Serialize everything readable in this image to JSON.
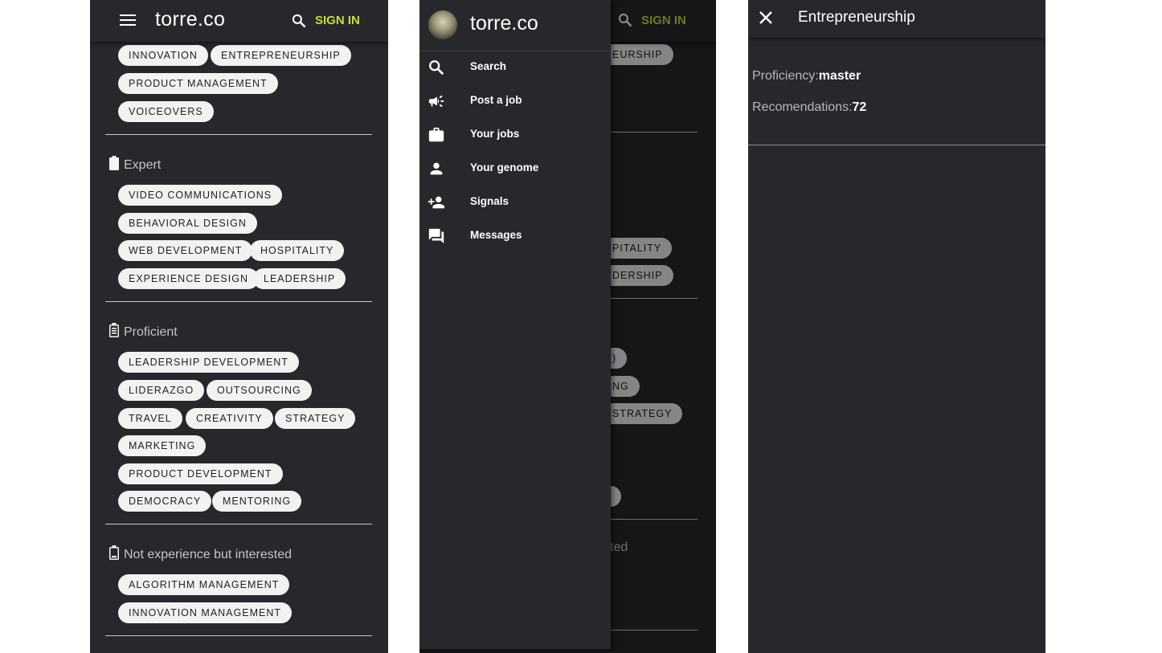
{
  "brand": "torre.co",
  "signin_label": "SIGN IN",
  "panel1": {
    "top_chips": [
      "INNOVATION",
      "ENTREPRENEURSHIP",
      "PRODUCT MANAGEMENT",
      "VOICEOVERS"
    ],
    "sections": [
      {
        "title": "Expert",
        "chips": [
          "VIDEO COMMUNICATIONS",
          "BEHAVIORAL DESIGN",
          "WEB DEVELOPMENT",
          "HOSPITALITY",
          "EXPERIENCE DESIGN",
          "LEADERSHIP"
        ]
      },
      {
        "title": "Proficient",
        "chips": [
          "LEADERSHIP DEVELOPMENT",
          "LIDERAZGO",
          "OUTSOURCING",
          "TRAVEL",
          "CREATIVITY",
          "STRATEGY",
          "MARKETING",
          "PRODUCT DEVELOPMENT",
          "DEMOCRACY",
          "MENTORING"
        ]
      },
      {
        "title": "Not experience but interested",
        "chips": [
          "ALGORITHM MANAGEMENT",
          "INNOVATION MANAGEMENT"
        ]
      }
    ]
  },
  "drawer": {
    "items": [
      {
        "label": "Search",
        "icon": "search-icon"
      },
      {
        "label": "Post a job",
        "icon": "megaphone-icon"
      },
      {
        "label": "Your jobs",
        "icon": "briefcase-icon"
      },
      {
        "label": "Your genome",
        "icon": "person-icon"
      },
      {
        "label": "Signals",
        "icon": "person-add-icon"
      },
      {
        "label": "Messages",
        "icon": "forum-icon"
      }
    ]
  },
  "panel2_bg": {
    "chips": [
      "EURSHIP",
      "PITALITY",
      "DERSHIP",
      ")",
      "NG",
      "STRATEGY",
      ""
    ],
    "text": "ted"
  },
  "detail": {
    "title": "Entrepreneurship",
    "proficiency_label": "Proficiency:",
    "proficiency_value": "master",
    "recommendations_label": "Recomendations:",
    "recommendations_value": "72"
  },
  "colors": {
    "background": "#27282c",
    "accent": "#cddc39",
    "chip": "#f2f2f2"
  }
}
